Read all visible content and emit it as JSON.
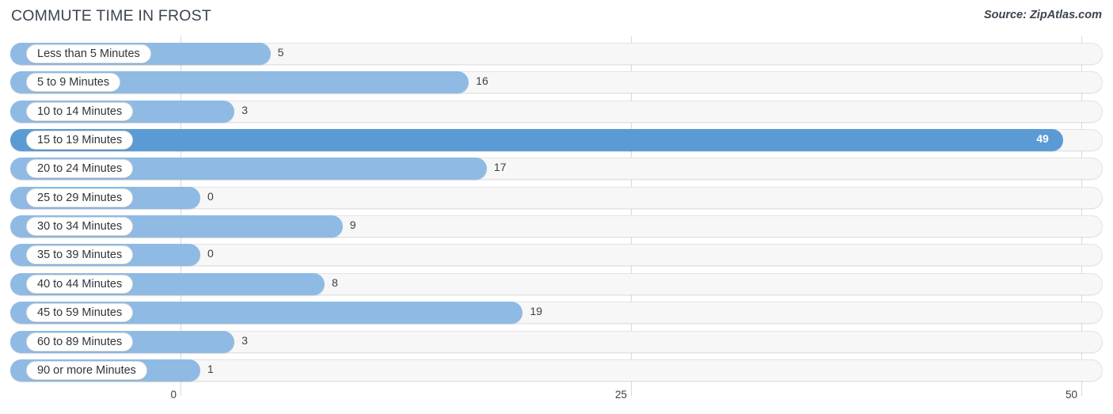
{
  "header": {
    "title": "COMMUTE TIME IN FROST",
    "source": "Source: ZipAtlas.com"
  },
  "colors": {
    "bar": "#8fbae4",
    "bar_highlight": "#5b9bd5",
    "track": "#f7f7f7",
    "track_border": "#e3e3e3",
    "gridline": "#d8d8d8",
    "text": "#3a3f45"
  },
  "chart_data": {
    "type": "bar",
    "orientation": "horizontal",
    "title": "COMMUTE TIME IN FROST",
    "subtitle": "Source: ZipAtlas.com",
    "xlabel": "",
    "ylabel": "",
    "xlim": [
      0,
      50
    ],
    "xticks": [
      0,
      25,
      50
    ],
    "xtick_labels": [
      "0",
      "25",
      "50"
    ],
    "grid": true,
    "legend": false,
    "highlight_index": 3,
    "categories": [
      "Less than 5 Minutes",
      "5 to 9 Minutes",
      "10 to 14 Minutes",
      "15 to 19 Minutes",
      "20 to 24 Minutes",
      "25 to 29 Minutes",
      "30 to 34 Minutes",
      "35 to 39 Minutes",
      "40 to 44 Minutes",
      "45 to 59 Minutes",
      "60 to 89 Minutes",
      "90 or more Minutes"
    ],
    "values": [
      5,
      16,
      3,
      49,
      17,
      0,
      9,
      0,
      8,
      19,
      3,
      1
    ],
    "value_labels": [
      "5",
      "16",
      "3",
      "49",
      "17",
      "0",
      "9",
      "0",
      "8",
      "19",
      "3",
      "1"
    ]
  }
}
